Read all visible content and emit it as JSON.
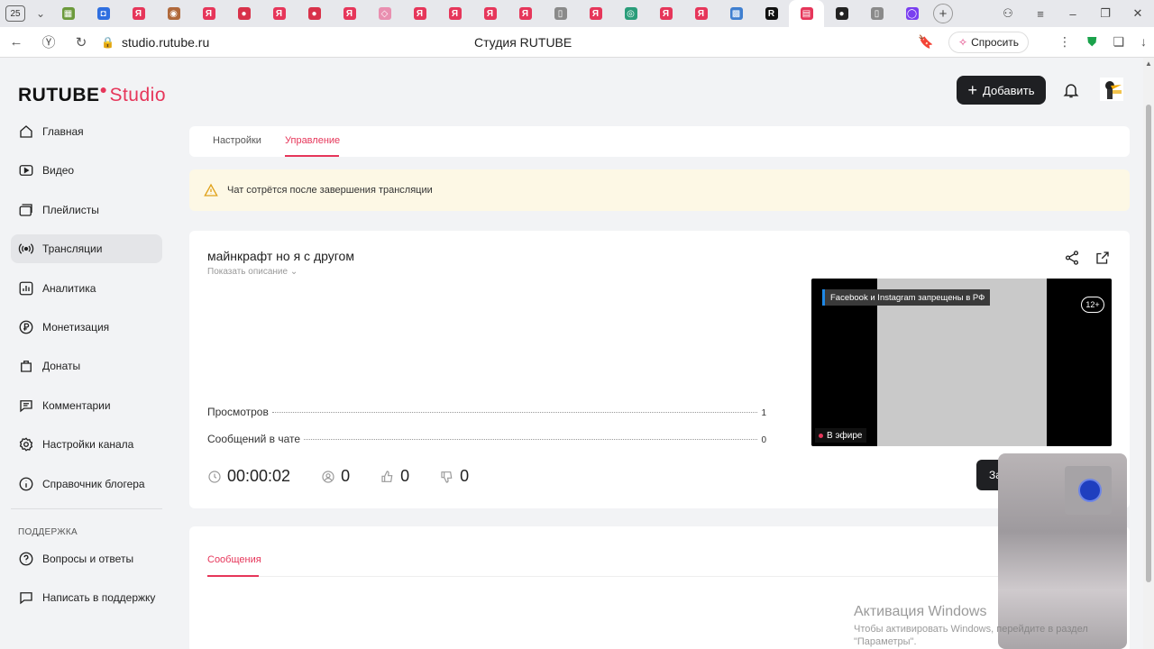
{
  "browser": {
    "tab_count": "25",
    "url": "studio.rutube.ru",
    "page_title": "Студия RUTUBE",
    "ask_button": "Спросить"
  },
  "header": {
    "logo_main": "RUTUBE",
    "logo_studio": "Studio",
    "add_button": "Добавить"
  },
  "sidebar": {
    "items": [
      {
        "label": "Главная",
        "icon": "home-icon"
      },
      {
        "label": "Видео",
        "icon": "video-icon"
      },
      {
        "label": "Плейлисты",
        "icon": "playlist-icon"
      },
      {
        "label": "Трансляции",
        "icon": "broadcast-icon",
        "active": true
      },
      {
        "label": "Аналитика",
        "icon": "analytics-icon"
      },
      {
        "label": "Монетизация",
        "icon": "ruble-icon"
      },
      {
        "label": "Донаты",
        "icon": "donate-icon"
      },
      {
        "label": "Комментарии",
        "icon": "comment-icon"
      },
      {
        "label": "Настройки канала",
        "icon": "gear-icon"
      },
      {
        "label": "Справочник блогера",
        "icon": "info-icon"
      }
    ],
    "support_section": "ПОДДЕРЖКА",
    "support_items": [
      {
        "label": "Вопросы и ответы",
        "icon": "question-icon"
      },
      {
        "label": "Написать в поддержку",
        "icon": "message-icon"
      }
    ]
  },
  "tabs": {
    "settings": "Настройки",
    "management": "Управление"
  },
  "warning": {
    "text": "Чат сотрётся после завершения трансляции"
  },
  "stream": {
    "title": "майнкрафт но я с другом",
    "show_description": "Показать описание",
    "stats": [
      {
        "label": "Просмотров",
        "value": "1"
      },
      {
        "label": "Сообщений в чате",
        "value": "0"
      }
    ],
    "preview_banner": "Facebook и Instagram запрещены в РФ",
    "age_rating": "12+",
    "live_label": "В эфире",
    "duration": "00:00:02",
    "viewers": "0",
    "likes": "0",
    "dislikes": "0",
    "end_button_partial": "За"
  },
  "chat": {
    "tab": "Сообщения"
  },
  "activation": {
    "line1": "Активация Windows",
    "line2": "Чтобы активировать Windows, перейдите в раздел",
    "line3": "\"Параметры\"."
  },
  "colors": {
    "accent": "#e6365a",
    "dark_button": "#1f2023",
    "warning_bg": "#fdf8e5"
  }
}
